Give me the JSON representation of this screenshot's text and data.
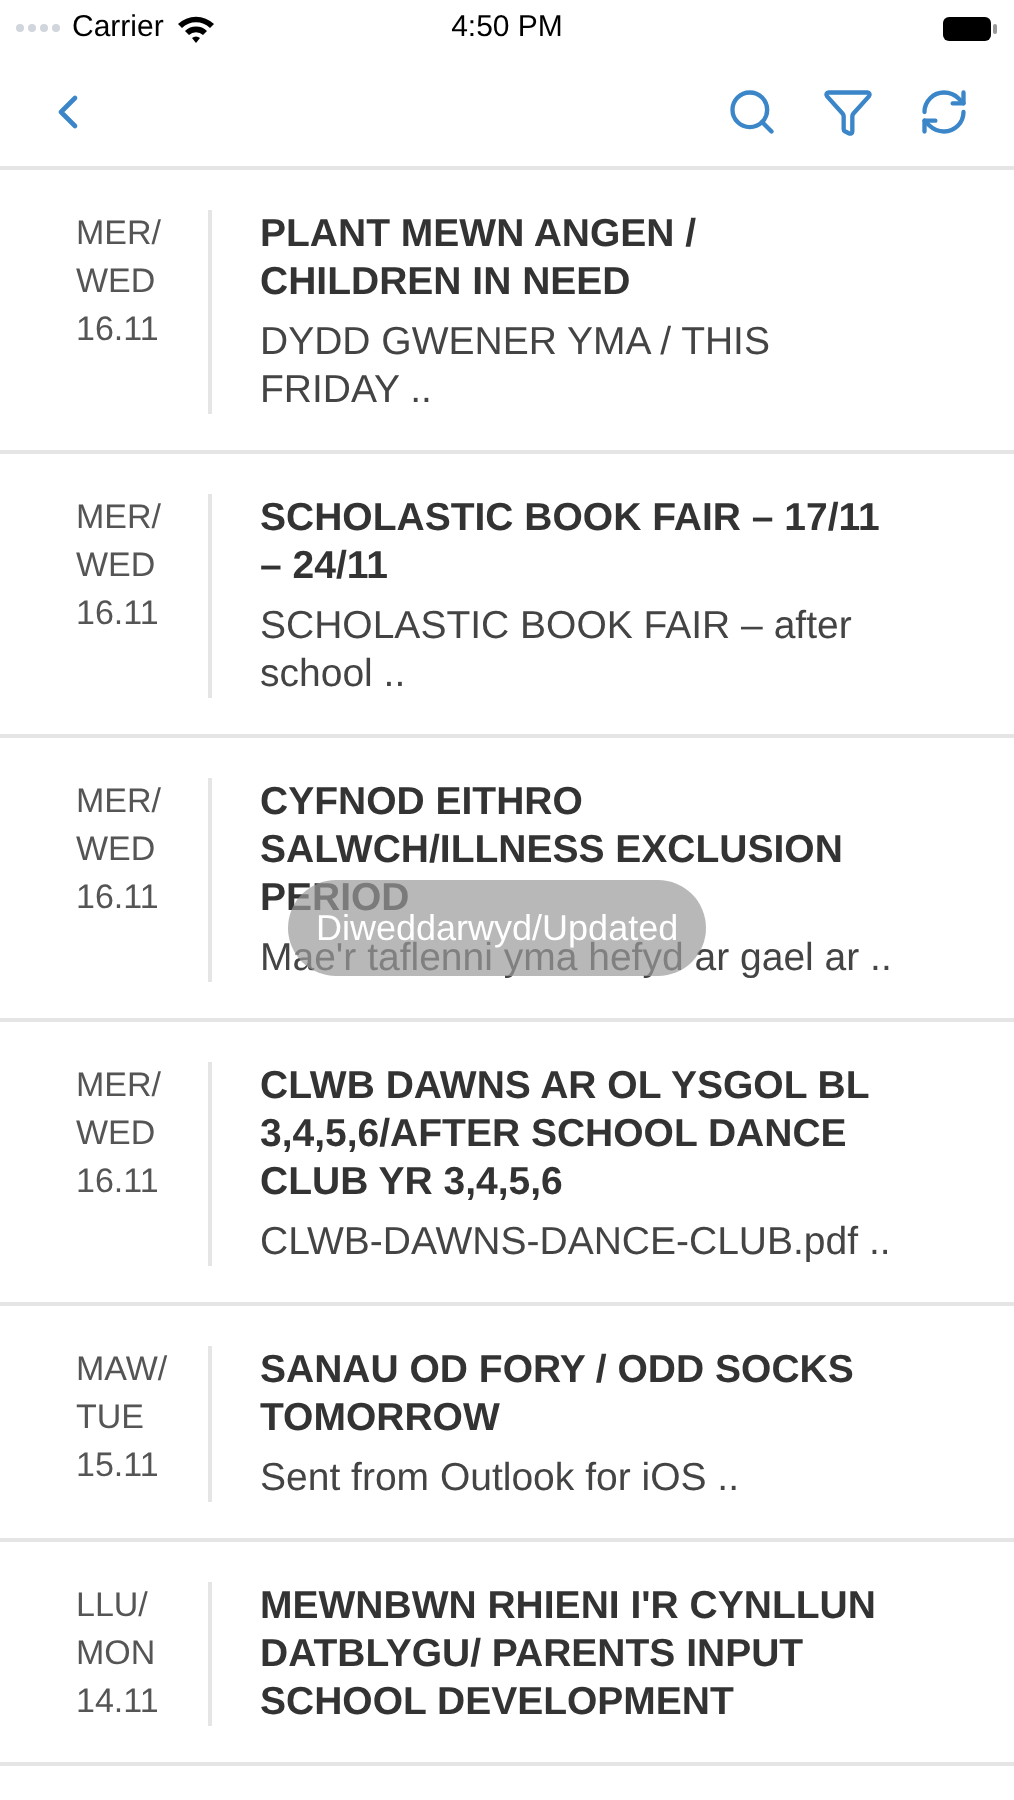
{
  "status_bar": {
    "carrier": "Carrier",
    "time": "4:50 PM"
  },
  "toast": "Diweddarwyd/Updated",
  "items": [
    {
      "date": [
        "MER/",
        "WED",
        "16.11"
      ],
      "title": "PLANT MEWN ANGEN / CHILDREN IN NEED",
      "summary": "DYDD GWENER YMA / THIS FRIDAY .."
    },
    {
      "date": [
        "MER/",
        "WED",
        "16.11"
      ],
      "title": "SCHOLASTIC BOOK FAIR – 17/11 – 24/11",
      "summary": "SCHOLASTIC BOOK FAIR – after school .."
    },
    {
      "date": [
        "MER/",
        "WED",
        "16.11"
      ],
      "title": "CYFNOD EITHRO SALWCH/ILLNESS EXCLUSION PERIOD",
      "summary": "Mae'r taflenni yma hefyd ar gael ar .."
    },
    {
      "date": [
        "MER/",
        "WED",
        "16.11"
      ],
      "title": "CLWB DAWNS AR OL YSGOL BL 3,4,5,6/AFTER SCHOOL DANCE CLUB YR 3,4,5,6",
      "summary": "CLWB-DAWNS-DANCE-CLUB.pdf .."
    },
    {
      "date": [
        "MAW/",
        "TUE",
        "15.11"
      ],
      "title": "SANAU OD FORY / ODD SOCKS TOMORROW",
      "summary": "Sent from Outlook for iOS .."
    },
    {
      "date": [
        "LLU/",
        "MON",
        "14.11"
      ],
      "title": "MEWNBWN RHIENI I'R CYNLLUN DATBLYGU/ PARENTS INPUT SCHOOL DEVELOPMENT"
    }
  ]
}
